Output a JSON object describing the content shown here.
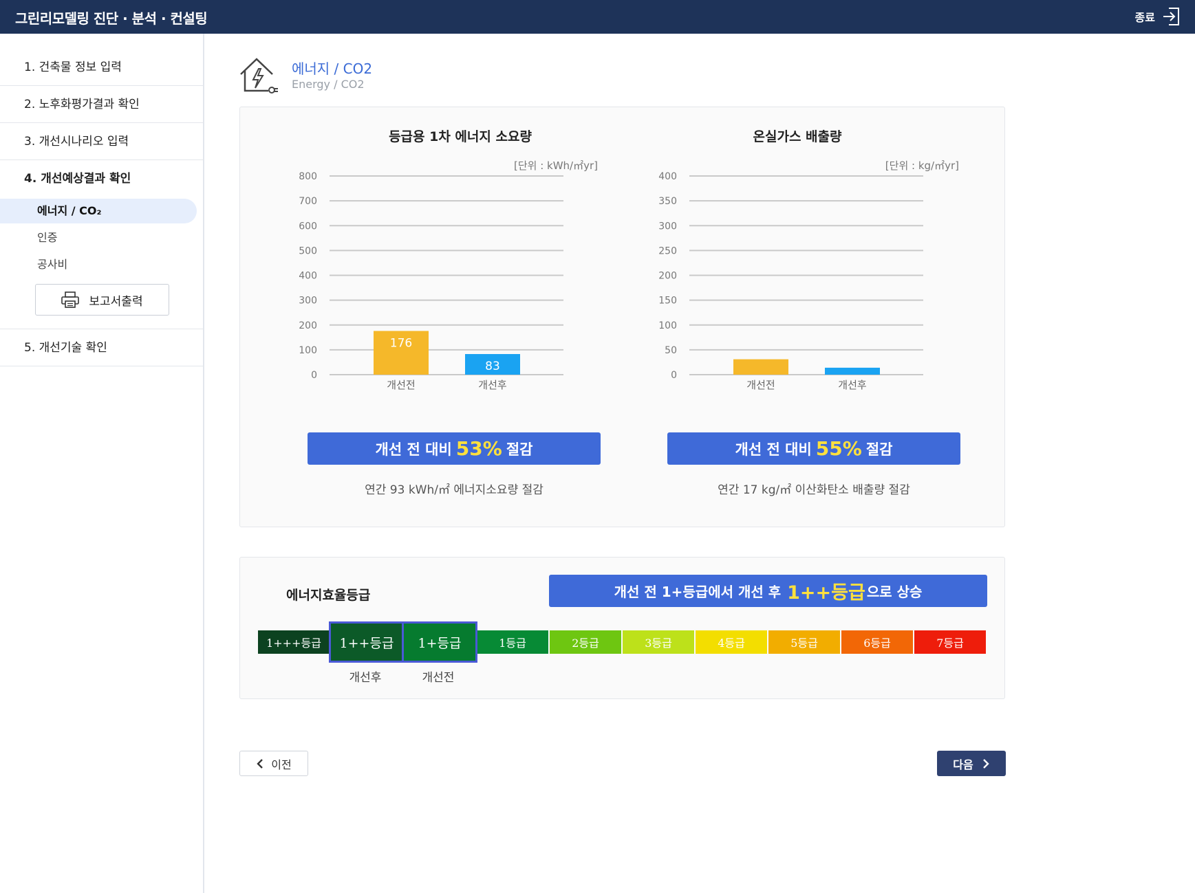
{
  "header": {
    "app_title": "그린리모델링 진단 · 분석 · 컨설팅",
    "exit_label": "종료"
  },
  "sidebar": {
    "items": [
      {
        "label": "1. 건축물 정보 입력"
      },
      {
        "label": "2. 노후화평가결과 확인"
      },
      {
        "label": "3. 개선시나리오 입력"
      },
      {
        "label": "4. 개선예상결과 확인"
      },
      {
        "label": "5. 개선기술 확인"
      }
    ],
    "sub_items": [
      {
        "label": "에너지 / CO₂"
      },
      {
        "label": "인증"
      },
      {
        "label": "공사비"
      }
    ],
    "report_button": "보고서출력"
  },
  "section": {
    "title": "에너지 / CO2",
    "subtitle": "Energy / CO2"
  },
  "energy": {
    "banner_prefix": "개선 전 대비",
    "percent": "53%",
    "banner_suffix": "절감",
    "annual_text": "연간 93 kWh/㎡   에너지소요량 절감"
  },
  "co2": {
    "banner_prefix": "개선 전 대비",
    "percent": "55%",
    "banner_suffix": "절감",
    "annual_text": "연간 17 kg/㎡   이산화탄소 배출량 절감"
  },
  "chart_data": [
    {
      "type": "bar",
      "title": "등급용 1차 에너지 소요량",
      "unit": "[단위 : kWh/㎡yr]",
      "categories": [
        "개선전",
        "개선후"
      ],
      "values": [
        176,
        83
      ],
      "data_labels": [
        "176",
        "83"
      ],
      "colors": [
        "#f5b82a",
        "#1aa3f2"
      ],
      "ylim": [
        0,
        800
      ],
      "yticks": [
        "0",
        "100",
        "200",
        "300",
        "400",
        "500",
        "600",
        "700",
        "800"
      ],
      "grid": true
    },
    {
      "type": "bar",
      "title": "온실가스 배출량",
      "unit": "[단위 : kg/㎡yr]",
      "categories": [
        "개선전",
        "개선후"
      ],
      "values": [
        31,
        14
      ],
      "data_labels": [
        "",
        ""
      ],
      "colors": [
        "#f5b82a",
        "#1aa3f2"
      ],
      "ylim": [
        0,
        400
      ],
      "yticks": [
        "0",
        "50",
        "100",
        "150",
        "200",
        "250",
        "300",
        "350",
        "400"
      ],
      "grid": true
    }
  ],
  "grade": {
    "title": "에너지효율등급",
    "banner_before": "개선 전 1+등급에서 개선 후",
    "banner_highlight": "1++등급",
    "banner_after": "으로 상승",
    "cells": [
      {
        "label": "1+++등급",
        "color": "#0c4220"
      },
      {
        "label": "1++등급",
        "color": "#0c5a28"
      },
      {
        "label": "1+등급",
        "color": "#067b2f"
      },
      {
        "label": "1등급",
        "color": "#078a35"
      },
      {
        "label": "2등급",
        "color": "#6ec611"
      },
      {
        "label": "3등급",
        "color": "#bde11a"
      },
      {
        "label": "4등급",
        "color": "#f3de00"
      },
      {
        "label": "5등급",
        "color": "#f2ad00"
      },
      {
        "label": "6등급",
        "color": "#f26706"
      },
      {
        "label": "7등급",
        "color": "#ee1d0b"
      }
    ],
    "after_label": "개선후",
    "before_label": "개선전"
  },
  "nav": {
    "prev_label": "이전",
    "next_label": "다음"
  }
}
